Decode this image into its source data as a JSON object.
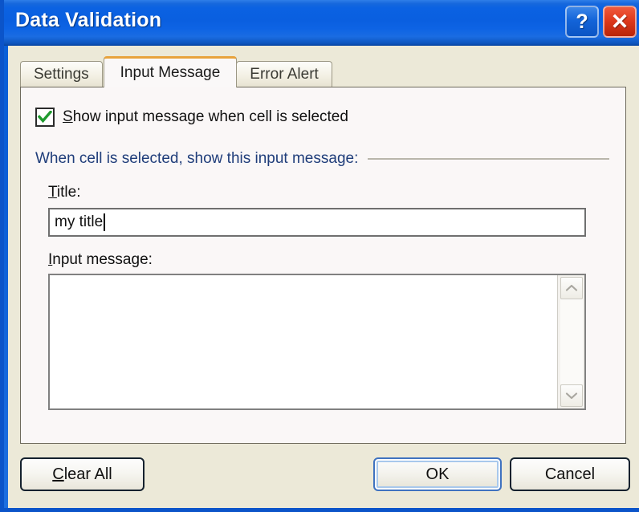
{
  "window": {
    "title": "Data Validation",
    "help_button": "?",
    "close_button": "✕"
  },
  "tabs": [
    {
      "label": "Settings",
      "active": false
    },
    {
      "label": "Input Message",
      "active": true
    },
    {
      "label": "Error Alert",
      "active": false
    }
  ],
  "panel": {
    "checkbox": {
      "label_accel": "S",
      "label_rest": "how input message when cell is selected",
      "checked": true
    },
    "group_header": "When cell is selected, show this input message:",
    "title_field": {
      "label_accel": "T",
      "label_rest": "itle:",
      "value": "my title",
      "placeholder": ""
    },
    "message_field": {
      "label_accel": "I",
      "label_rest": "nput message:",
      "value": "",
      "placeholder": ""
    },
    "scrollbar": {
      "up_icon": "chevron-up-icon",
      "down_icon": "chevron-down-icon"
    }
  },
  "buttons": {
    "clear_all_accel": "C",
    "clear_all_rest": "lear All",
    "ok": "OK",
    "cancel": "Cancel"
  },
  "colors": {
    "titlebar_blue": "#0a5fe0",
    "dialog_beige": "#ece9d8",
    "panel_white": "#faf7f7",
    "active_tab_accent": "#e8a33d",
    "group_header_blue": "#1f3d7a",
    "check_green": "#1f9a2e",
    "close_red": "#df3a1c",
    "default_button_focus": "#3f72c0"
  }
}
